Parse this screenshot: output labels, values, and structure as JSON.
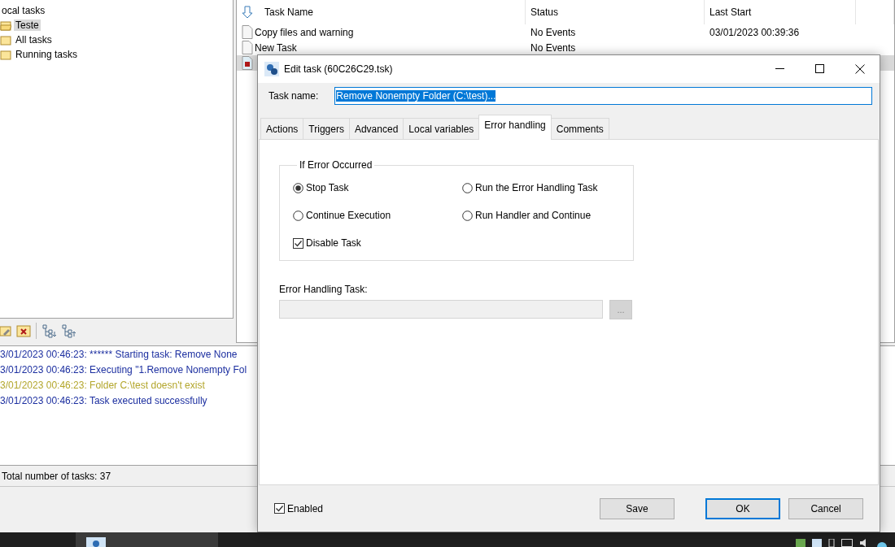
{
  "tree": {
    "root": "ocal tasks",
    "children": [
      {
        "label": "Teste",
        "selected": true,
        "open": true
      },
      {
        "label": "All tasks",
        "selected": false,
        "open": false
      },
      {
        "label": "Running tasks",
        "selected": false,
        "open": false
      }
    ]
  },
  "task_list": {
    "columns": [
      "Task Name",
      "Status",
      "Last Start"
    ],
    "rows": [
      {
        "name": "Copy files and warning",
        "status": "No Events",
        "last_start": "03/01/2023 00:39:36",
        "selected": false,
        "kind": "file"
      },
      {
        "name": "New Task",
        "status": "No Events",
        "last_start": "",
        "selected": false,
        "kind": "file"
      },
      {
        "name": "",
        "status": "",
        "last_start": "",
        "selected": true,
        "kind": "stopped"
      }
    ]
  },
  "log": [
    {
      "text": "3/01/2023 00:46:23: ****** Starting task: Remove None",
      "color": "#1c2fa0"
    },
    {
      "text": "3/01/2023 00:46:23: Executing \"1.Remove Nonempty Fol",
      "color": "#1c2fa0"
    },
    {
      "text": "3/01/2023 00:46:23: Folder C:\\test doesn't exist",
      "color": "#b3a62c"
    },
    {
      "text": "3/01/2023 00:46:23: Task executed successfully",
      "color": "#1c2fa0"
    }
  ],
  "status_bar": "Total number of tasks: 37",
  "dialog": {
    "title": "Edit task (60C26C29.tsk)",
    "task_name_label": "Task name:",
    "task_name_value": "Remove Nonempty Folder  (C:\\test)...",
    "tabs": [
      {
        "label": "Actions",
        "selected": false
      },
      {
        "label": "Triggers",
        "selected": false
      },
      {
        "label": "Advanced",
        "selected": false
      },
      {
        "label": "Local variables",
        "selected": false
      },
      {
        "label": "Error handling",
        "selected": true
      },
      {
        "label": "Comments",
        "selected": false
      }
    ],
    "group_title": "If Error Occurred",
    "options": [
      {
        "label": "Stop Task",
        "kind": "radio",
        "checked": true
      },
      {
        "label": "Run the Error Handling Task",
        "kind": "radio",
        "checked": false
      },
      {
        "label": "Continue Execution",
        "kind": "radio",
        "checked": false
      },
      {
        "label": "Run Handler and Continue",
        "kind": "radio",
        "checked": false
      },
      {
        "label": "Disable Task",
        "kind": "checkbox",
        "checked": true
      }
    ],
    "handler_label": "Error Handling Task:",
    "browse_button": "...",
    "enabled": {
      "label": "Enabled",
      "checked": true
    },
    "buttons": [
      {
        "label": "Save",
        "default": false
      },
      {
        "label": "OK",
        "default": true
      },
      {
        "label": "Cancel",
        "default": false
      }
    ]
  }
}
